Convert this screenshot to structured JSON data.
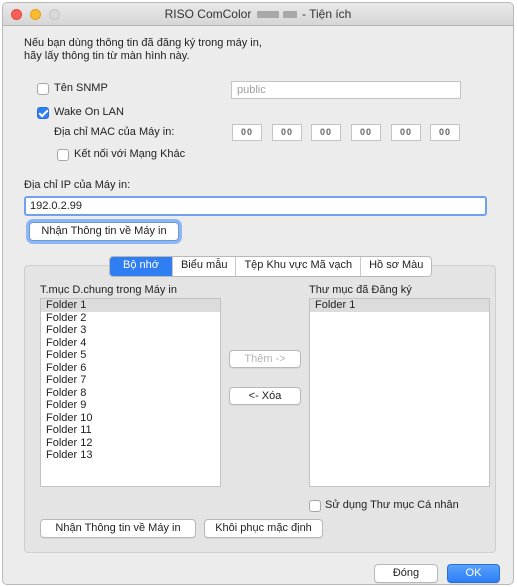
{
  "window": {
    "title_prefix": "RISO ComColor",
    "title_suffix": "- Tiện ích"
  },
  "intro": {
    "line1": "Nếu bạn dùng thông tin đã đăng ký trong máy in,",
    "line2": "hãy lấy thông tin từ màn hình này."
  },
  "snmp": {
    "label": "Tên SNMP",
    "checked": false,
    "value": "public"
  },
  "wol": {
    "label": "Wake On LAN",
    "checked": true,
    "mac_label": "Địa chỉ MAC của Máy in:",
    "mac_values": [
      "00",
      "00",
      "00",
      "00",
      "00",
      "00"
    ],
    "other_network_label": "Kết nối với Mạng Khác",
    "other_network_checked": false
  },
  "ip": {
    "label": "Địa chỉ IP của Máy in:",
    "value": "192.0.2.99"
  },
  "get_info_button": "Nhận Thông tin về Máy in",
  "tabs": [
    {
      "label": "Bộ nhớ",
      "active": true
    },
    {
      "label": "Biểu mẫu",
      "active": false
    },
    {
      "label": "Tệp Khu vực Mã vạch",
      "active": false
    },
    {
      "label": "Hồ sơ Màu",
      "active": false
    }
  ],
  "shared_folders": {
    "label": "T.mục D.chung trong Máy in",
    "items": [
      "Folder 1",
      "Folder 2",
      "Folder 3",
      "Folder 4",
      "Folder 5",
      "Folder 6",
      "Folder 7",
      "Folder 8",
      "Folder 9",
      "Folder 10",
      "Folder 11",
      "Folder 12",
      "Folder 13"
    ]
  },
  "registered_folders": {
    "label": "Thư mục đã Đăng ký",
    "items": [
      "Folder 1"
    ]
  },
  "add_button": "Thêm ->",
  "delete_button": "<- Xóa",
  "personal_folder": {
    "label": "Sử dụng Thư mục Cá nhân",
    "checked": false
  },
  "panel_get_info_button": "Nhận Thông tin về Máy in",
  "restore_default_button": "Khôi phục mặc định",
  "close_button": "Đóng",
  "ok_button": "OK"
}
